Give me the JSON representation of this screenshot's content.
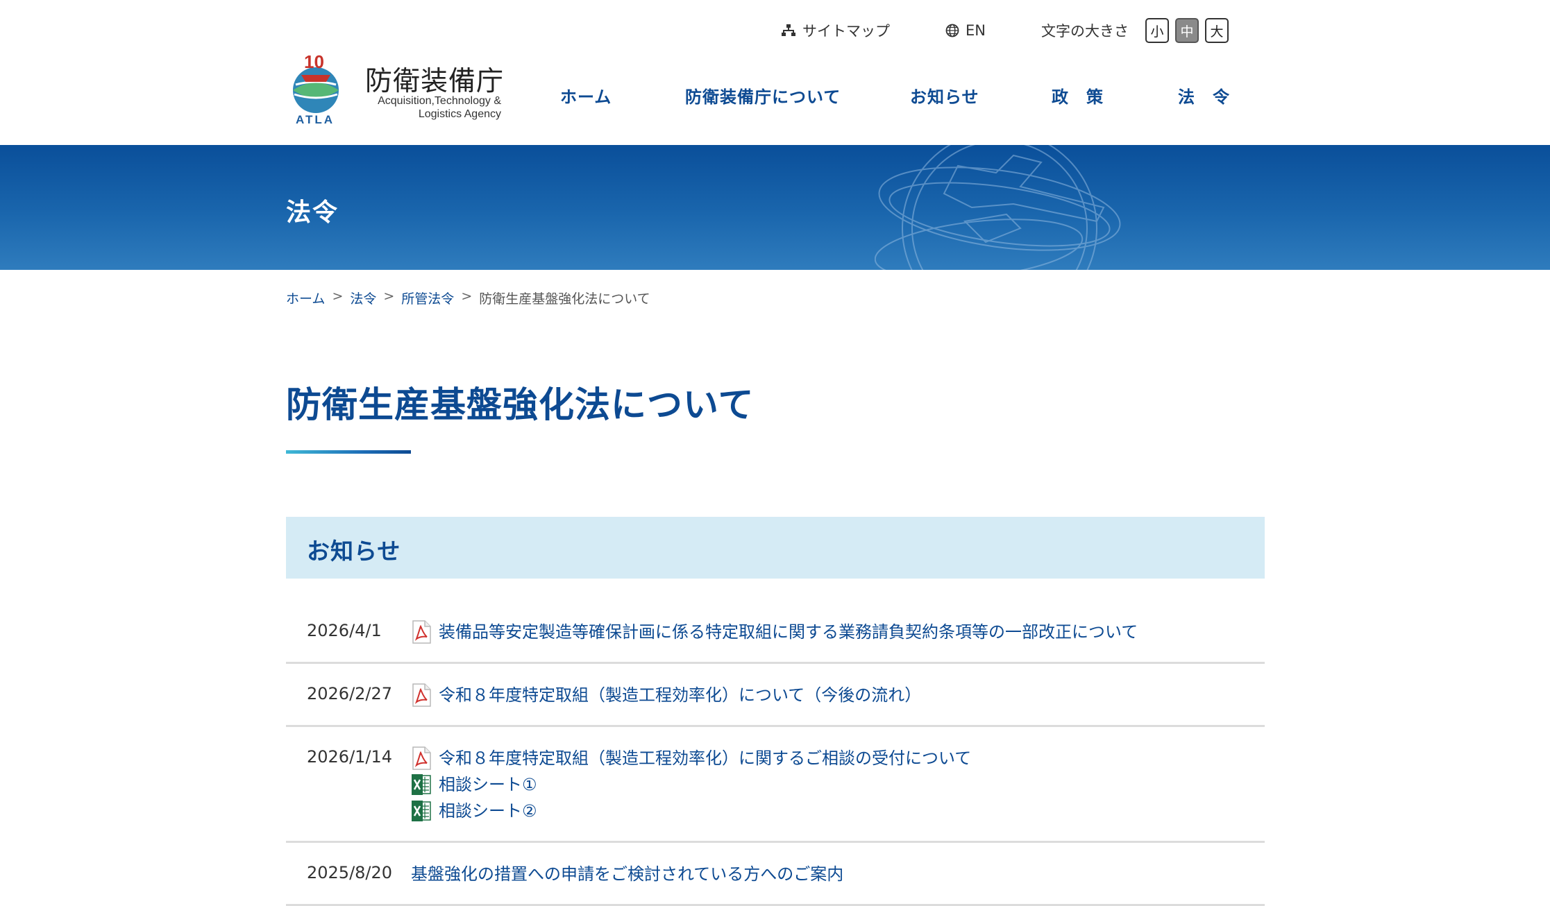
{
  "header": {
    "logo_anniversary": "10",
    "logo_atla": "ATLA",
    "logo_jp": "防衛装備庁",
    "logo_en_line1": "Acquisition,Technology &",
    "logo_en_line2": "Logistics Agency",
    "utility": {
      "sitemap_label": "サイトマップ",
      "en_label": "EN",
      "font_size_label": "文字の大きさ",
      "size_small": "小",
      "size_medium": "中",
      "size_large": "大",
      "active_size": "中"
    },
    "nav": [
      {
        "label": "ホーム"
      },
      {
        "label": "防衛装備庁について"
      },
      {
        "label": "お知らせ"
      },
      {
        "label": "政　策"
      },
      {
        "label": "法　令"
      }
    ]
  },
  "banner": {
    "title": "法令"
  },
  "breadcrumb": {
    "items": [
      "ホーム",
      "法令",
      "所管法令",
      "防衛生産基盤強化法について"
    ],
    "separator": ">"
  },
  "page": {
    "title": "防衛生産基盤強化法について"
  },
  "notices": {
    "heading": "お知らせ",
    "rows": [
      {
        "date": "2026/4/1",
        "links": [
          {
            "type": "pdf",
            "text": "装備品等安定製造等確保計画に係る特定取組に関する業務請負契約条項等の一部改正について"
          }
        ]
      },
      {
        "date": "2026/2/27",
        "links": [
          {
            "type": "pdf",
            "text": "令和８年度特定取組（製造工程効率化）について（今後の流れ）"
          }
        ]
      },
      {
        "date": "2026/1/14",
        "links": [
          {
            "type": "pdf",
            "text": "令和８年度特定取組（製造工程効率化）に関するご相談の受付について"
          },
          {
            "type": "xls",
            "text": "相談シート①"
          },
          {
            "type": "xls",
            "text": "相談シート②"
          }
        ]
      },
      {
        "date": "2025/8/20",
        "links": [
          {
            "type": "none",
            "text": "基盤強化の措置への申請をご検討されている方へのご案内"
          }
        ]
      }
    ]
  },
  "colors": {
    "brand_blue": "#0d4a92",
    "section_bg": "#d5ebf5",
    "banner_top": "#0a4f9a",
    "banner_bottom": "#2f7cbd"
  }
}
